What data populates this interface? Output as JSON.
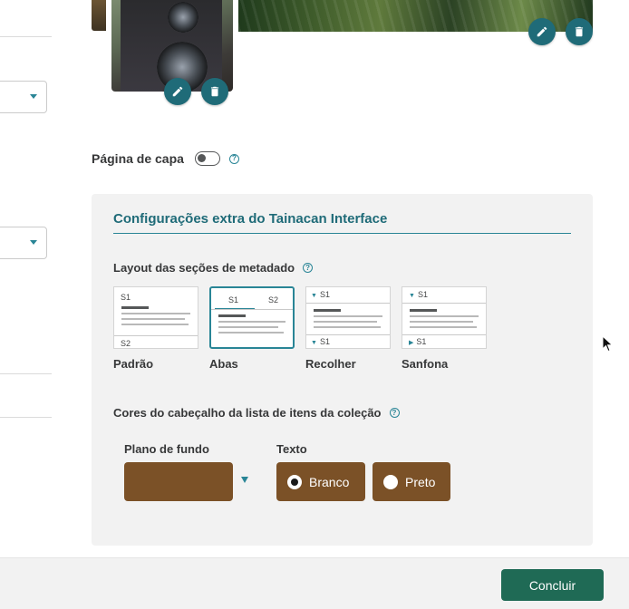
{
  "gallery": {
    "images": [
      {
        "name": "thumbnail-partial"
      },
      {
        "name": "camera-photo"
      },
      {
        "name": "landscape-photo"
      }
    ],
    "edit_icon": "pencil-icon",
    "delete_icon": "trash-icon"
  },
  "cover_page": {
    "label": "Página de capa",
    "enabled": false,
    "help": "?"
  },
  "extra_config": {
    "title": "Configurações extra do Tainacan Interface",
    "layout_section": {
      "label": "Layout das seções de metadado",
      "help": "?",
      "selected": "Abas",
      "options": [
        {
          "label": "Padrão",
          "top": "S1",
          "bottom": "S2"
        },
        {
          "label": "Abas",
          "tab1": "S1",
          "tab2": "S2"
        },
        {
          "label": "Recolher",
          "top": "S1",
          "bottom": "S1"
        },
        {
          "label": "Sanfona",
          "top": "S1",
          "bottom": "S1"
        }
      ]
    },
    "header_colors": {
      "label": "Cores do cabeçalho da lista de itens da coleção",
      "help": "?",
      "background_label": "Plano de fundo",
      "background_color": "#7b5127",
      "text_label": "Texto",
      "text_options": [
        {
          "label": "Branco",
          "checked": true
        },
        {
          "label": "Preto",
          "checked": false
        }
      ]
    }
  },
  "footer": {
    "submit_label": "Concluir"
  },
  "colors": {
    "accent": "#298596",
    "primary_button": "#1f6a55",
    "round_button": "#1f6b78",
    "panel_bg": "#f2f2f2"
  }
}
